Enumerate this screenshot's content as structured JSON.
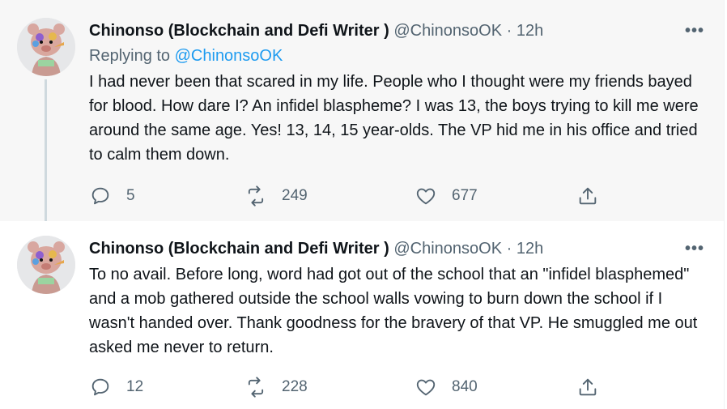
{
  "tweets": [
    {
      "author_name": "Chinonso (Blockchain and Defi Writer )",
      "handle": "@ChinonsoOK",
      "separator": "·",
      "time": "12h",
      "more": "•••",
      "replying_prefix": "Replying to",
      "replying_to": "@ChinonsoOK",
      "text": "I had never been that scared in my life. People who I thought were my friends bayed for blood. How dare I? An infidel blaspheme? I was 13, the boys trying to kill me were around the same age. Yes! 13, 14, 15 year-olds. The VP hid me in his office and tried to calm them down.",
      "replies": "5",
      "retweets": "249",
      "likes": "677"
    },
    {
      "author_name": "Chinonso (Blockchain and Defi Writer )",
      "handle": "@ChinonsoOK",
      "separator": "·",
      "time": "12h",
      "more": "•••",
      "text": "To no avail. Before long, word had got out of the school that an \"infidel blasphemed\" and a mob gathered outside the school walls vowing to burn down the school if I wasn't handed over. Thank goodness for the bravery of that VP. He smuggled me out asked me never to return.",
      "replies": "12",
      "retweets": "228",
      "likes": "840"
    }
  ],
  "colors": {
    "text": "#0f1419",
    "secondary": "#536471",
    "accent": "#1d9bf0",
    "highlight_bg": "#f7f7f7",
    "thread_line": "#cfd9de"
  },
  "icons": {
    "reply": "reply-bubble-icon",
    "retweet": "retweet-icon",
    "like": "heart-icon",
    "share": "share-upload-icon",
    "more": "more-dots-icon"
  }
}
